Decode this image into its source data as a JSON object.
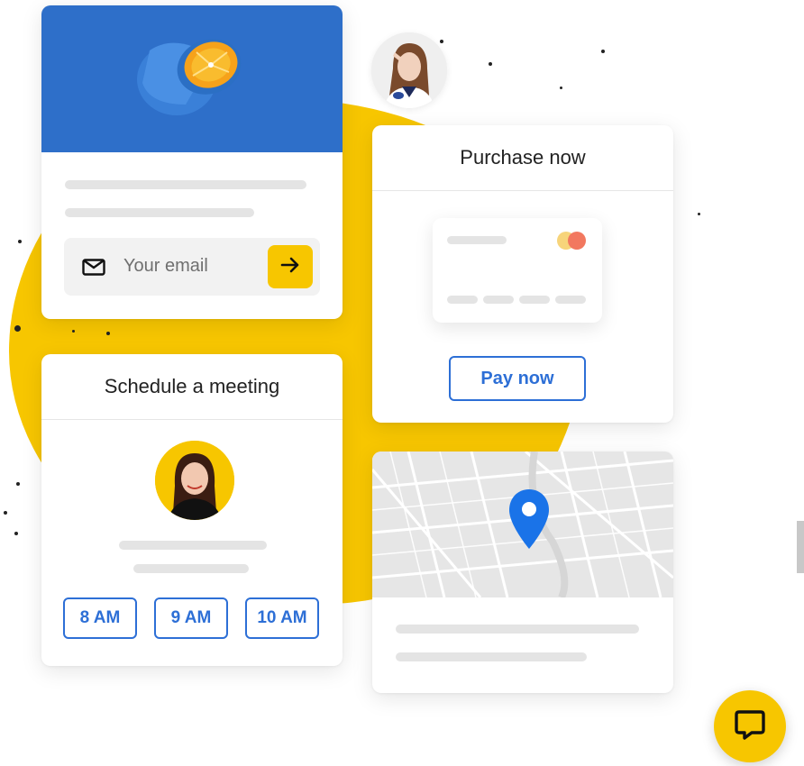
{
  "newsletter_card": {
    "email_placeholder": "Your email",
    "icons": [
      "envelope-icon",
      "arrow-right-icon"
    ]
  },
  "schedule_card": {
    "title": "Schedule a meeting",
    "time_slots": [
      "8 AM",
      "9 AM",
      "10 AM"
    ]
  },
  "purchase_card": {
    "title": "Purchase now",
    "pay_button_label": "Pay now",
    "icons": [
      "credit-card-icon",
      "mastercard-logo-icon"
    ]
  },
  "map_card": {
    "icons": [
      "map-pin-icon"
    ]
  },
  "chat_widget": {
    "icon": "chat-bubble-icon"
  },
  "colors": {
    "accent_yellow": "#f7c600",
    "button_blue": "#2d6fd6",
    "pin_blue": "#1a73e8",
    "photo_background_blue": "#2e6fc9"
  }
}
